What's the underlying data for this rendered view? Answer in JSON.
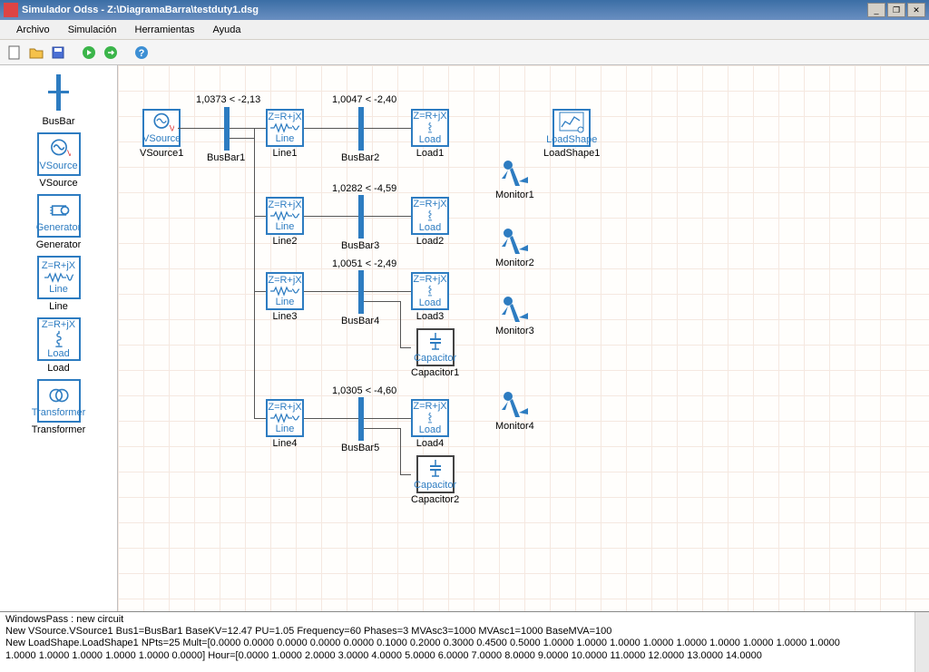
{
  "window": {
    "title": "Simulador Odss - Z:\\DiagramaBarra\\testduty1.dsg"
  },
  "menu": {
    "archivo": "Archivo",
    "simulacion": "Simulación",
    "herramientas": "Herramientas",
    "ayuda": "Ayuda"
  },
  "palette": {
    "busbar": "BusBar",
    "vsource": "VSource",
    "generator": "Generator",
    "line": "Line",
    "load": "Load",
    "transformer": "Transformer",
    "zrjx": "Z=R+jX"
  },
  "nodes": {
    "vsource1": "VSource1",
    "busbar1": "BusBar1",
    "line1": "Line1",
    "busbar2": "BusBar2",
    "load1": "Load1",
    "loadshape1": "LoadShape1",
    "line2": "Line2",
    "busbar3": "BusBar3",
    "load2": "Load2",
    "monitor1": "Monitor1",
    "line3": "Line3",
    "busbar4": "BusBar4",
    "load3": "Load3",
    "capacitor1": "Capacitor1",
    "monitor2": "Monitor2",
    "line4": "Line4",
    "busbar5": "BusBar5",
    "load4": "Load4",
    "capacitor2": "Capacitor2",
    "monitor3": "Monitor3",
    "monitor4": "Monitor4"
  },
  "annot": {
    "a1": "1,0373 < -2,13",
    "a2": "1,0047 < -2,40",
    "a3": "1,0282 < -4,59",
    "a4": "1,0051 < -2,49",
    "a5": "1,0305 < -4,60"
  },
  "boxlabels": {
    "vsource": "VSource",
    "line": "Line",
    "load": "Load",
    "generator": "Generator",
    "transformer": "Transformer",
    "loadshape": "LoadShape",
    "capacitor": "Capacitor"
  },
  "console": {
    "l1": "WindowsPass : new circuit",
    "l2": "New VSource.VSource1 Bus1=BusBar1 BaseKV=12.47 PU=1.05 Frequency=60 Phases=3 MVAsc3=1000 MVAsc1=1000 BaseMVA=100",
    "l3": "New LoadShape.LoadShape1 NPts=25 Mult=[0.0000 0.0000 0.0000 0.0000 0.0000 0.1000 0.2000 0.3000 0.4500 0.5000 1.0000 1.0000 1.0000 1.0000 1.0000 1.0000 1.0000 1.0000 1.0000",
    "l4": "1.0000 1.0000 1.0000 1.0000 1.0000 0.0000] Hour=[0.0000 1.0000 2.0000 3.0000 4.0000 5.0000 6.0000 7.0000 8.0000 9.0000 10.0000 11.0000 12.0000 13.0000 14.0000"
  }
}
